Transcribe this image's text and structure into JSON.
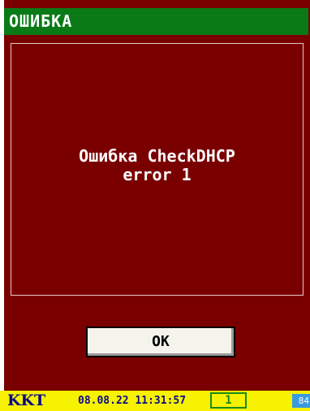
{
  "dialog": {
    "title": "ОШИБКА",
    "message_line1": "Ошибка CheckDHCP",
    "message_line2": "error 1",
    "ok_label": "OK"
  },
  "status_bar": {
    "device_label": "KKT",
    "datetime": "08.08.22 11:31:57",
    "counter": "1",
    "battery": "84"
  },
  "colors": {
    "background": "#7a0000",
    "title_bar": "#0a7a16",
    "status_bar": "#f6f200",
    "status_text": "#0a0a8a",
    "counter_border": "#1a8a1a",
    "battery": "#3a9adf"
  }
}
